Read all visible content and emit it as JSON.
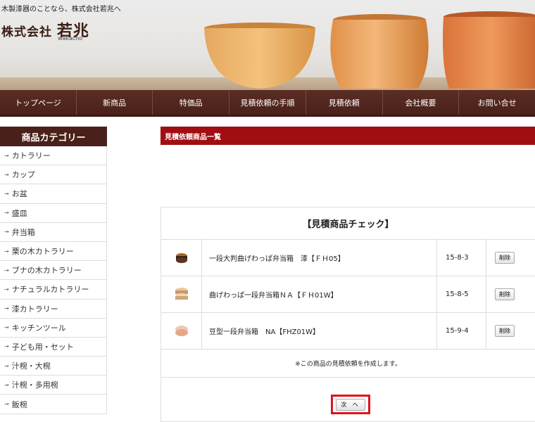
{
  "header": {
    "tagline": "木製漆器のことなら、株式会社若兆へ",
    "brand_prefix": "株式会社",
    "brand_main": "若兆",
    "brand_sub": "wakacho"
  },
  "nav": [
    "トップページ",
    "新商品",
    "特価品",
    "見積依頼の手順",
    "見積依頼",
    "会社概要",
    "お問い合せ"
  ],
  "sidebar": {
    "title": "商品カテゴリー",
    "items": [
      "カトラリー",
      "カップ",
      "お盆",
      "盛皿",
      "弁当箱",
      "栗の木カトラリー",
      "ブナの木カトラリー",
      "ナチュラルカトラリー",
      "漆カトラリー",
      "キッチンツール",
      "子ども用・セット",
      "汁椀・大椀",
      "汁椀・多用椀",
      "飯椀"
    ]
  },
  "main": {
    "section_title": "見積依頼商品一覧",
    "panel_title": "【見積商品チェック】",
    "products": [
      {
        "name": "一段大判曲げわっぱ弁当箱　漆【ＦＨ05】",
        "code": "15-8-3",
        "delete_label": "削除",
        "icon": "lacquer-bento-icon"
      },
      {
        "name": "曲げわっぱ一段弁当箱ＮＡ【ＦＨ01W】",
        "code": "15-8-5",
        "delete_label": "削除",
        "icon": "natural-bento-icon"
      },
      {
        "name": "豆型一段弁当箱　NA【FHZ01W】",
        "code": "15-9-4",
        "delete_label": "削除",
        "icon": "bean-bento-icon"
      }
    ],
    "notice": "※この商品の見積依頼を作成します。",
    "next_label": "次 へ"
  },
  "colors": {
    "nav_bg": "#4a211a",
    "accent_red": "#a10e12",
    "highlight": "#e0141b"
  }
}
